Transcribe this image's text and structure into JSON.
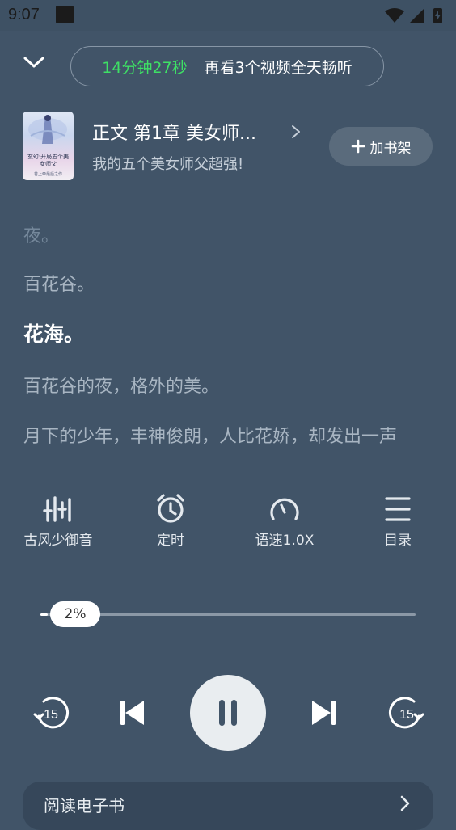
{
  "status_bar": {
    "time": "9:07",
    "icons": [
      "notification-icon",
      "wifi-icon",
      "signal-icon",
      "battery-charging-icon"
    ]
  },
  "header": {
    "collapse_icon": "chevron-down-icon",
    "promo_timer": "14分钟27秒",
    "promo_text": "再看3个视频全天畅听"
  },
  "book": {
    "cover_title": "玄幻:开局五个美女师父",
    "cover_author": "苍上帝最后之作",
    "chapter_title": "正文 第1章 美女师...",
    "book_name": "我的五个美女师父超强!",
    "add_shelf_label": "加书架"
  },
  "reader_text": {
    "lines": [
      "夜。",
      "百花谷。",
      "花海。",
      "百花谷的夜，格外的美。",
      "月下的少年，丰神俊朗，人比花娇，却发出一声"
    ],
    "active_line_index": 2
  },
  "features": [
    {
      "label": "古风少御音",
      "icon": "voice-equalizer-icon"
    },
    {
      "label": "定时",
      "icon": "alarm-clock-icon"
    },
    {
      "label": "语速1.0X",
      "icon": "speedometer-icon"
    },
    {
      "label": "目录",
      "icon": "menu-list-icon"
    }
  ],
  "progress": {
    "percent_label": "2%",
    "value": 0.02
  },
  "controls": {
    "rewind_seconds": "15",
    "forward_seconds": "15",
    "state": "playing"
  },
  "ebook_bar": {
    "label": "阅读电子书"
  },
  "colors": {
    "background": "#415468",
    "accent_green": "#3ee065",
    "play_button": "#e9edf0",
    "dim_text": "#a8b5c2"
  }
}
